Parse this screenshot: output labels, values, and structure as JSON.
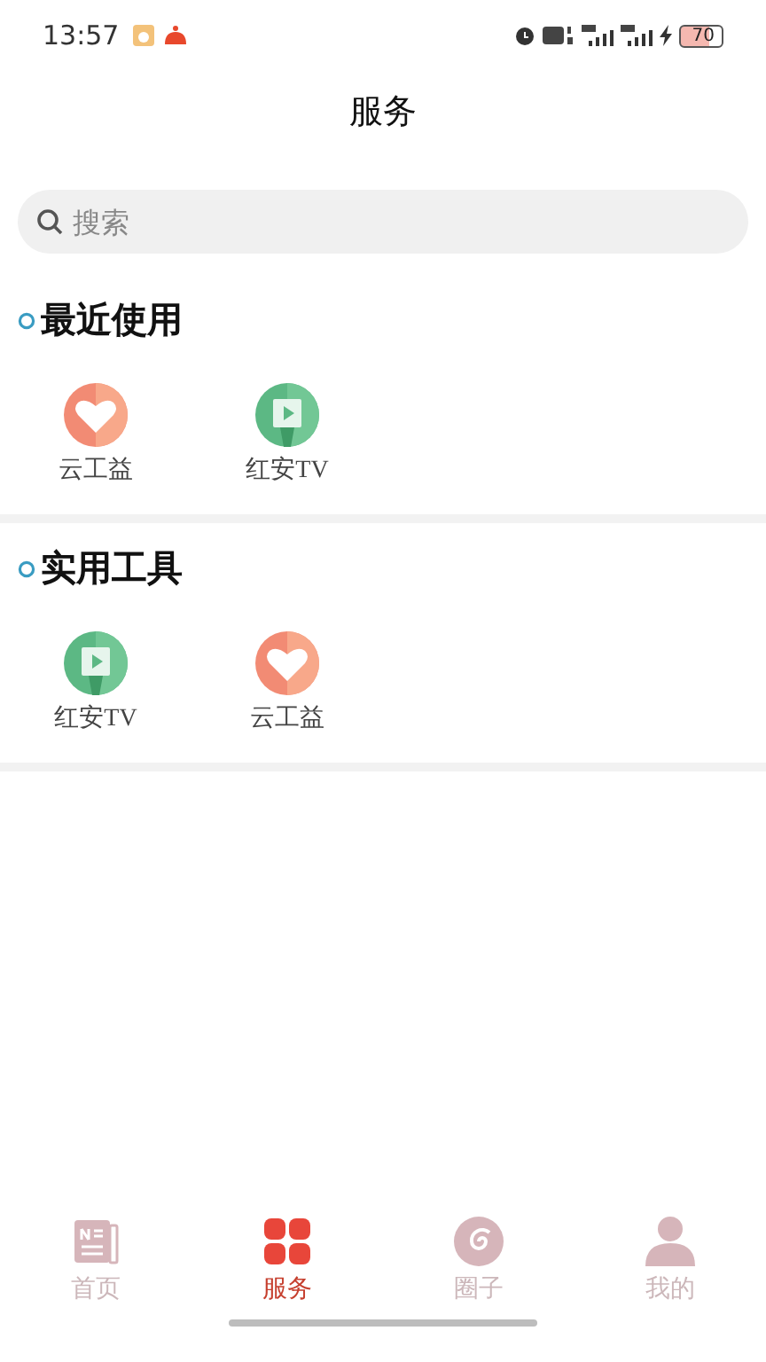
{
  "status_bar": {
    "time": "13:57",
    "battery": "70"
  },
  "title": "服务",
  "search": {
    "placeholder": "搜索"
  },
  "sections": [
    {
      "title": "最近使用",
      "items": [
        {
          "kind": "heart",
          "label": "云工益"
        },
        {
          "kind": "tv",
          "label": "红安TV"
        }
      ]
    },
    {
      "title": "实用工具",
      "items": [
        {
          "kind": "tv",
          "label": "红安TV"
        },
        {
          "kind": "heart",
          "label": "云工益"
        }
      ]
    }
  ],
  "tabs": [
    {
      "kind": "news",
      "label": "首页",
      "selected": false
    },
    {
      "kind": "grid",
      "label": "服务",
      "selected": true
    },
    {
      "kind": "circle",
      "label": "圈子",
      "selected": false
    },
    {
      "kind": "person",
      "label": "我的",
      "selected": false
    }
  ]
}
